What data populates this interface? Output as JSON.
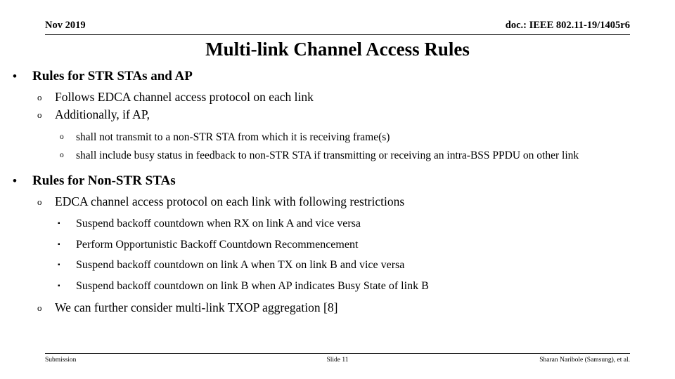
{
  "header": {
    "date": "Nov 2019",
    "doc": "doc.: IEEE 802.11-19/1405r6"
  },
  "title": "Multi-link Channel Access Rules",
  "markers": {
    "bullet": "•",
    "circle": "o",
    "square": "▪"
  },
  "content": {
    "section1": {
      "heading": "Rules for STR STAs and AP",
      "items": [
        "Follows EDCA channel access protocol on each link",
        "Additionally, if AP,"
      ],
      "subitems": [
        "shall not transmit to a non-STR STA from which it is receiving frame(s)",
        "shall include busy status in feedback to non-STR STA if transmitting or receiving an intra-BSS PPDU on other link"
      ]
    },
    "section2": {
      "heading": "Rules for Non-STR STAs",
      "item_intro": "EDCA channel access protocol on each link with following restrictions",
      "restrictions": [
        "Suspend backoff countdown when RX on link A and vice versa",
        "Perform Opportunistic Backoff Countdown Recommencement",
        "Suspend backoff countdown on link A when TX on link B and vice versa",
        "Suspend backoff countdown on link B when AP indicates Busy State of link B"
      ],
      "item_outro": "We can further consider multi-link TXOP aggregation [8]"
    }
  },
  "footer": {
    "left": "Submission",
    "center": "Slide 11",
    "right": "Sharan Naribole (Samsung), et al."
  }
}
